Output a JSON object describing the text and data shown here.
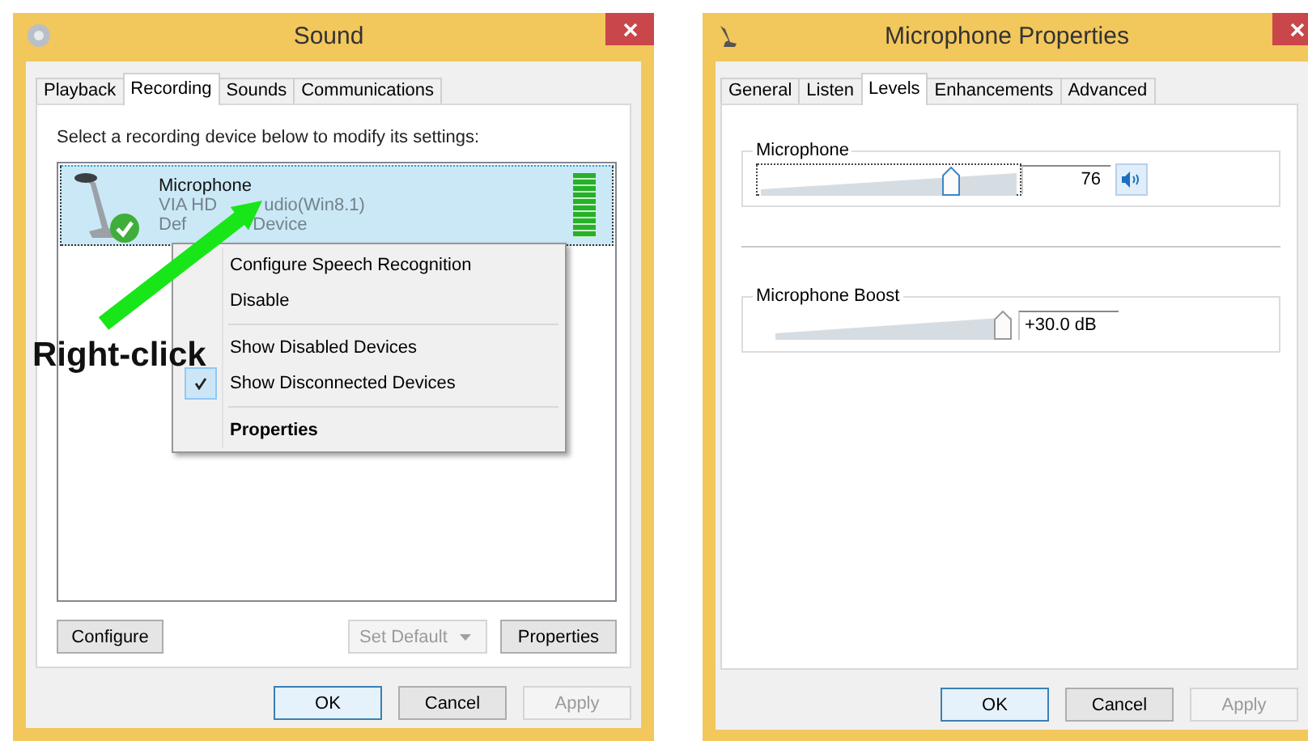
{
  "sound_window": {
    "title": "Sound",
    "tabs": [
      {
        "label": "Playback",
        "selected": false
      },
      {
        "label": "Recording",
        "selected": true
      },
      {
        "label": "Sounds",
        "selected": false
      },
      {
        "label": "Communications",
        "selected": false
      }
    ],
    "instruction": "Select a recording device below to modify its settings:",
    "devices": [
      {
        "name": "Microphone",
        "driver": [
          "VIA HD",
          "udio(Win8.1)"
        ],
        "status": [
          "Def",
          "Device"
        ],
        "selected": true,
        "is_default": true,
        "level": 1
      }
    ],
    "buttons": [
      {
        "label": "Configure",
        "disabled": false,
        "dropdown": false
      },
      {
        "label": "Set Default",
        "disabled": true,
        "dropdown": true
      },
      {
        "label": "Properties",
        "disabled": false,
        "dropdown": false
      }
    ],
    "dialog_buttons": [
      {
        "label": "OK",
        "default": true,
        "disabled": false
      },
      {
        "label": "Cancel",
        "default": false,
        "disabled": false
      },
      {
        "label": "Apply",
        "default": false,
        "disabled": true
      }
    ]
  },
  "context_menu": {
    "items": [
      {
        "kind": "item",
        "label": "Configure Speech Recognition",
        "checked": false,
        "default": false
      },
      {
        "kind": "item",
        "label": "Disable",
        "checked": false,
        "default": false
      },
      {
        "kind": "separator"
      },
      {
        "kind": "item",
        "label": "Show Disabled Devices",
        "checked": false,
        "default": false
      },
      {
        "kind": "item",
        "label": "Show Disconnected Devices",
        "checked": true,
        "default": false
      },
      {
        "kind": "separator"
      },
      {
        "kind": "item",
        "label": "Properties",
        "checked": false,
        "default": true
      }
    ]
  },
  "annotation": {
    "text": "Right-click"
  },
  "properties_window": {
    "title": "Microphone Properties",
    "tabs": [
      {
        "label": "General",
        "selected": false
      },
      {
        "label": "Listen",
        "selected": false
      },
      {
        "label": "Levels",
        "selected": true
      },
      {
        "label": "Enhancements",
        "selected": false
      },
      {
        "label": "Advanced",
        "selected": false
      }
    ],
    "groups": [
      {
        "label": "Microphone",
        "level": 0.76,
        "value": "76",
        "kind": "volume",
        "muted": false
      },
      {
        "label": "Microphone Boost",
        "level": 1,
        "value": "+30.0 dB",
        "kind": "boost"
      }
    ],
    "dialog_buttons": [
      {
        "label": "OK",
        "default": true,
        "disabled": false
      },
      {
        "label": "Cancel",
        "default": false,
        "disabled": false
      },
      {
        "label": "Apply",
        "default": false,
        "disabled": true
      }
    ]
  }
}
